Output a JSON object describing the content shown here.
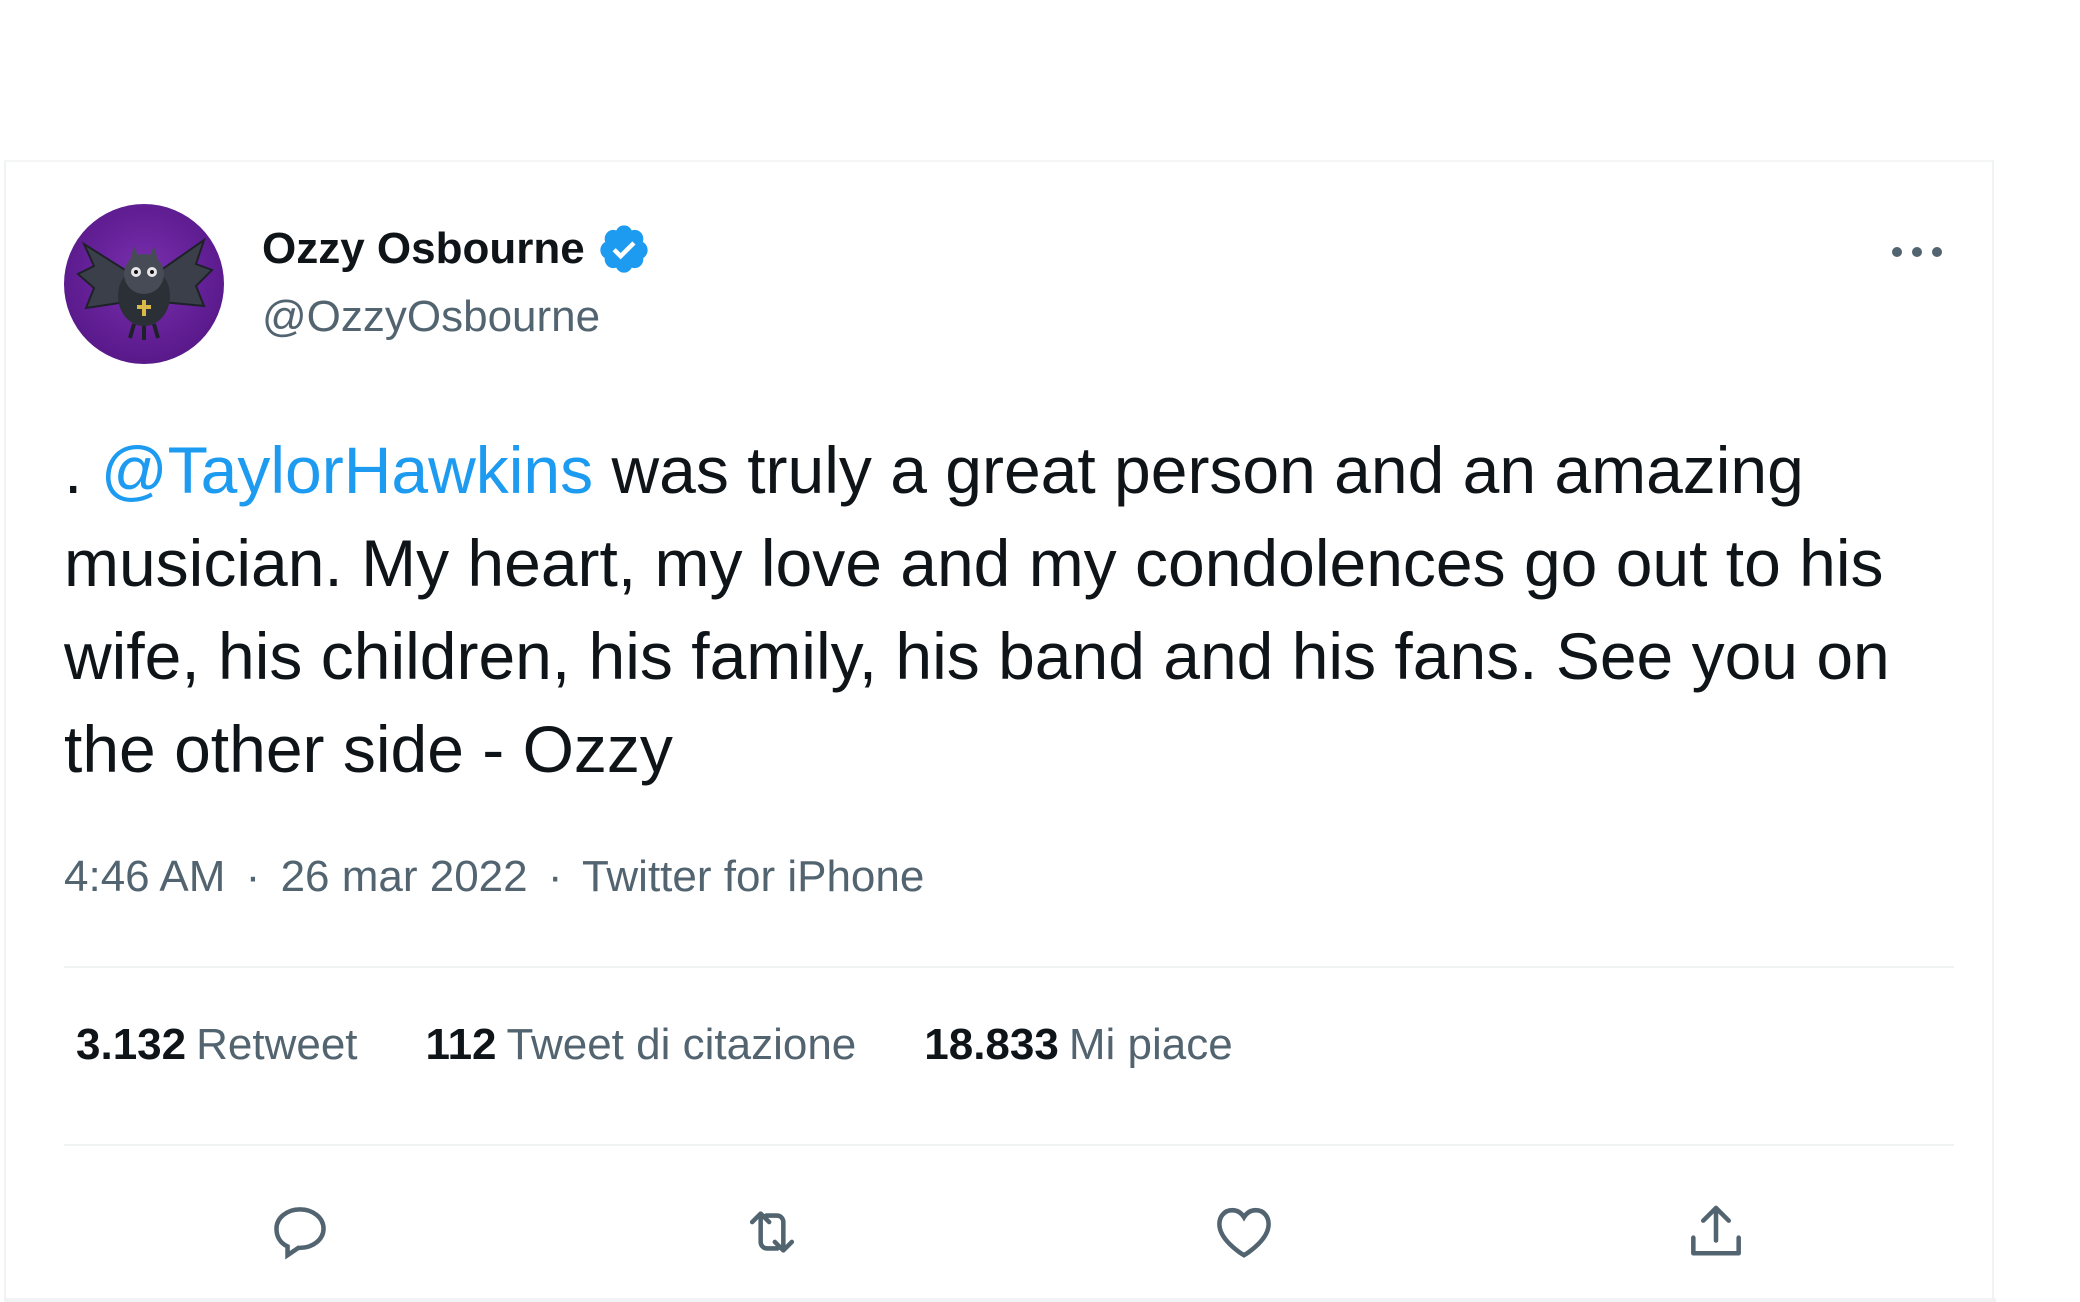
{
  "tweet": {
    "author": {
      "display_name": "Ozzy Osbourne",
      "handle": "@OzzyOsbourne",
      "verified": true,
      "avatar_icon": "bat-avatar-icon"
    },
    "text": {
      "prefix": ". ",
      "mention": "@TaylorHawkins",
      "body": " was truly a great person and an amazing musician. My heart, my love and my condolences go out to his wife, his children, his family, his band and his fans. See you on the other side - Ozzy"
    },
    "meta": {
      "time": "4:46 AM",
      "date": "26 mar 2022",
      "source": "Twitter for iPhone",
      "separator": "·"
    },
    "stats": [
      {
        "count": "3.132",
        "label": "Retweet"
      },
      {
        "count": "112",
        "label": "Tweet di citazione"
      },
      {
        "count": "18.833",
        "label": "Mi piace"
      }
    ],
    "actions": [
      {
        "icon": "reply-icon"
      },
      {
        "icon": "retweet-icon"
      },
      {
        "icon": "like-icon"
      },
      {
        "icon": "share-icon"
      }
    ],
    "more_icon": "more-options-icon"
  },
  "colors": {
    "accent": "#1d9bf0",
    "text_primary": "#0f1419",
    "text_secondary": "#536471",
    "avatar_bg": "#5a1a8c"
  }
}
